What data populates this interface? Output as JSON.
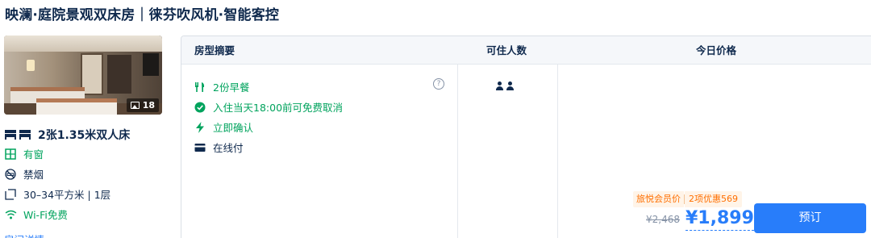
{
  "room": {
    "title": "映澜·庭院景观双床房｜徕芬吹风机·智能客控",
    "photo_count": "18",
    "features": {
      "bed": "2张1.35米双人床",
      "window": "有窗",
      "smoking": "禁烟",
      "area": "30–34平方米 | 1层",
      "wifi": "Wi-Fi免费"
    },
    "details_link": "房间详情"
  },
  "table": {
    "headers": {
      "summary": "房型摘要",
      "guests": "可住人数",
      "price": "今日价格"
    }
  },
  "offer": {
    "policies": {
      "breakfast": "2份早餐",
      "cancel": "入住当天18:00前可免费取消",
      "confirm": "立即确认",
      "payment": "在线付"
    },
    "guest_count": 2,
    "member_label": "旅悦会员价",
    "discount_label": "2项优惠569",
    "original_price": "¥2,468",
    "price": "¥1,899",
    "book_label": "预订"
  },
  "colors": {
    "accent": "#287dfa",
    "green": "#00a35d",
    "orange": "#ff6f00"
  }
}
